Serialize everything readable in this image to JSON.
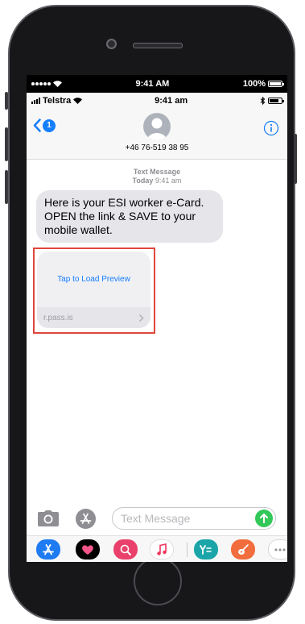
{
  "simulator_status": {
    "time": "9:41 AM",
    "battery": "100%"
  },
  "app_status": {
    "carrier": "Telstra",
    "time": "9:41 am"
  },
  "header": {
    "unread_count": "1",
    "contact": "+46 76-519 38 95"
  },
  "thread": {
    "label": "Text Message",
    "day": "Today",
    "time": "9:41 am",
    "message": "Here is your ESI worker e-Card. OPEN the link & SAVE to your mobile wallet.",
    "preview_action": "Tap to Load Preview",
    "preview_domain": "r.pass.is"
  },
  "composer": {
    "placeholder": "Text Message"
  },
  "app_drawer": [
    {
      "icon": "app-store-icon",
      "color": "#1e7bf2"
    },
    {
      "icon": "heart-sticker-icon",
      "color": "#000000"
    },
    {
      "icon": "web-search-icon",
      "color": "#e9416b"
    },
    {
      "icon": "music-icon",
      "color": "#ffffff"
    },
    {
      "icon": "yelp-style-app-icon",
      "color": "#1ba5a8"
    },
    {
      "icon": "guitar-app-icon",
      "color": "#f26d3d"
    },
    {
      "icon": "more-icon",
      "color": "#ffffff"
    }
  ],
  "colors": {
    "accent": "#147efb",
    "bubble": "#e5e5ea",
    "highlight": "#e0463d",
    "send": "#34c759"
  }
}
